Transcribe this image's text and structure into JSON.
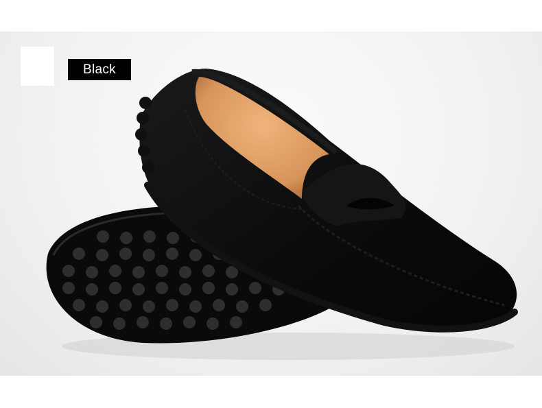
{
  "product": {
    "color_label": "Black",
    "colors": {
      "suede": "#0b0b0b",
      "lining": "#d8955a",
      "background": "#f1f1f1"
    }
  }
}
